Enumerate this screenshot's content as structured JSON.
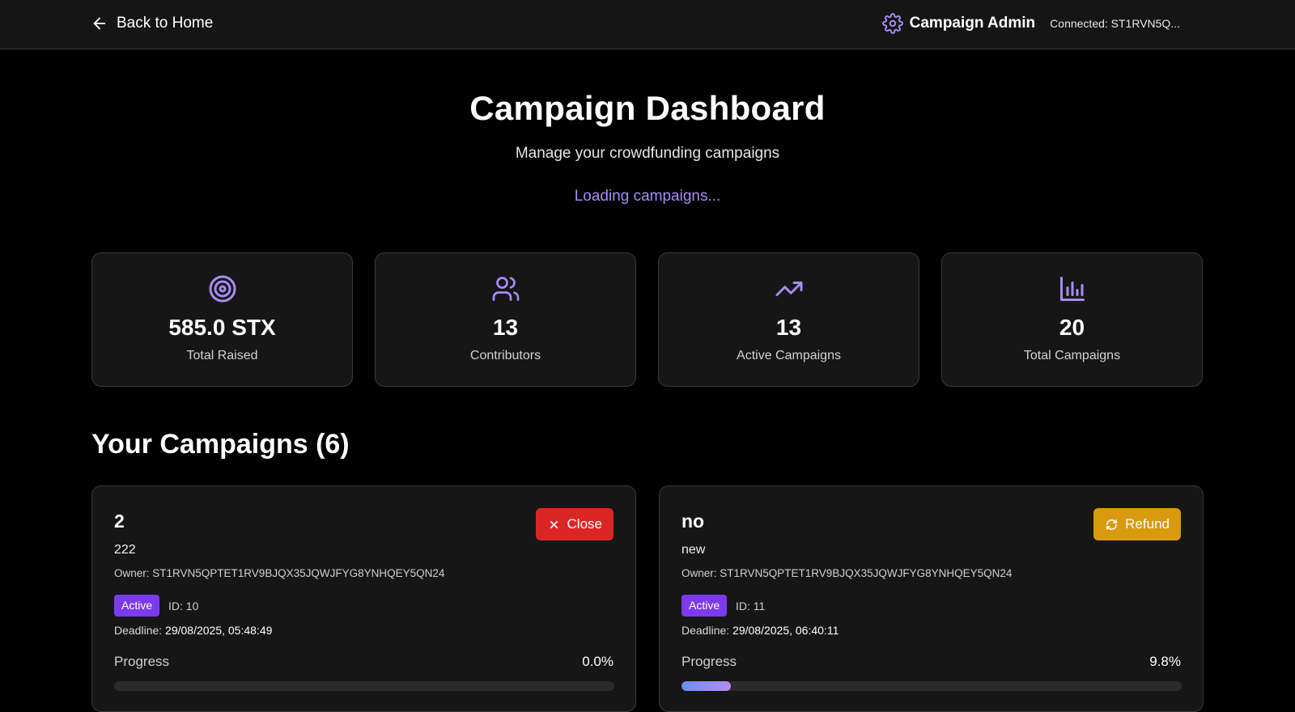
{
  "header": {
    "back_label": "Back to Home",
    "admin_title": "Campaign Admin",
    "connected": "Connected: ST1RVN5Q..."
  },
  "hero": {
    "title": "Campaign Dashboard",
    "subtitle": "Manage your crowdfunding campaigns",
    "loading": "Loading campaigns..."
  },
  "stats": [
    {
      "icon": "target-icon",
      "value": "585.0 STX",
      "label": "Total Raised"
    },
    {
      "icon": "users-icon",
      "value": "13",
      "label": "Contributors"
    },
    {
      "icon": "trending-up-icon",
      "value": "13",
      "label": "Active Campaigns"
    },
    {
      "icon": "bar-chart-icon",
      "value": "20",
      "label": "Total Campaigns"
    }
  ],
  "campaigns_section": {
    "title": "Your Campaigns (6)"
  },
  "campaigns": [
    {
      "name": "2",
      "description": "222",
      "owner": "Owner: ST1RVN5QPTET1RV9BJQX35JQWJFYG8YNHQEY5QN24",
      "status": "Active",
      "id": "ID: 10",
      "deadline_label": "Deadline:",
      "deadline": "29/08/2025, 05:48:49",
      "progress_label": "Progress",
      "progress_text": "0.0%",
      "progress": 0.0,
      "action": {
        "label": "Close",
        "icon": "x-icon",
        "color": "#dc2626"
      }
    },
    {
      "name": "no",
      "description": "new",
      "owner": "Owner: ST1RVN5QPTET1RV9BJQX35JQWJFYG8YNHQEY5QN24",
      "status": "Active",
      "id": "ID: 11",
      "deadline_label": "Deadline:",
      "deadline": "29/08/2025, 06:40:11",
      "progress_label": "Progress",
      "progress_text": "9.8%",
      "progress": 9.8,
      "action": {
        "label": "Refund",
        "icon": "refresh-icon",
        "color": "#d99a10"
      }
    }
  ],
  "colors": {
    "accent": "#a88bf5",
    "badge": "#7c3aed"
  }
}
